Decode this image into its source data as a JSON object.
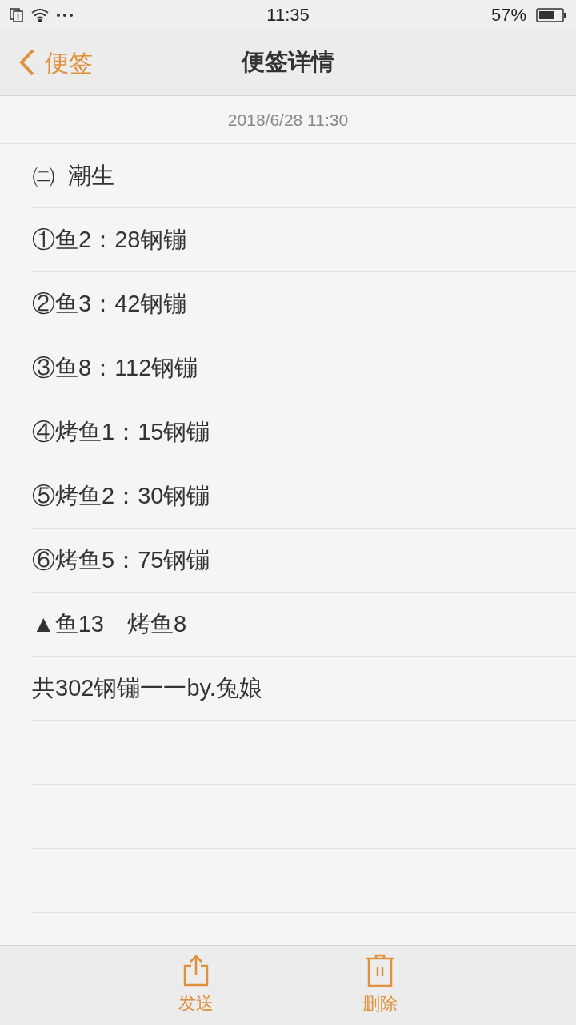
{
  "status_bar": {
    "time": "11:35",
    "battery": "57%"
  },
  "nav": {
    "back": "便签",
    "title": "便签详情"
  },
  "note": {
    "date": "2018/6/28 11:30",
    "lines": [
      "㈡  潮生",
      "①鱼2：28钢镚",
      "②鱼3：42钢镚",
      "③鱼8：112钢镚",
      "④烤鱼1：15钢镚",
      "⑤烤鱼2：30钢镚",
      "⑥烤鱼5：75钢镚",
      "▲鱼13　烤鱼8",
      "共302钢镚一一by.兔娘"
    ]
  },
  "toolbar": [
    {
      "kind": "send",
      "label": "发送"
    },
    {
      "kind": "delete",
      "label": "删除"
    }
  ]
}
